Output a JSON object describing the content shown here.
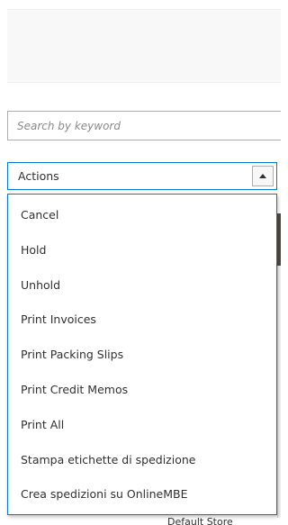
{
  "search": {
    "placeholder": "Search by keyword",
    "value": ""
  },
  "actions": {
    "label": "Actions",
    "toggle_icon": "triangle-up-icon",
    "accent_color": "#007bdb",
    "menu_items": [
      "Cancel",
      "Hold",
      "Unhold",
      "Print Invoices",
      "Print Packing Slips",
      "Print Credit Memos",
      "Print All",
      "Stampa etichette di spedizione",
      "Crea spedizioni su OnlineMBE"
    ]
  },
  "grid_behind": {
    "partial_text": "Default Store"
  }
}
